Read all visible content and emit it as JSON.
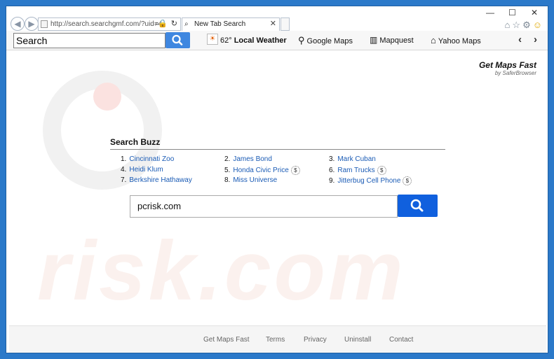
{
  "browser": {
    "address_url": "http://search.searchgmf.com/?uid=4",
    "tab_title": "New Tab Search",
    "back_icon": "back-arrow-icon",
    "forward_icon": "forward-arrow-icon"
  },
  "toolbar": {
    "search_value": "Search",
    "weather": {
      "temp": "62°",
      "label": "Local Weather"
    },
    "links": [
      "Google Maps",
      "Mapquest",
      "Yahoo Maps"
    ]
  },
  "brand": {
    "name": "Get Maps Fast",
    "by": "by SaferBrowser"
  },
  "buzz": {
    "title": "Search Buzz",
    "items": [
      {
        "num": "1.",
        "label": "Cincinnati Zoo"
      },
      {
        "num": "2.",
        "label": "James Bond"
      },
      {
        "num": "3.",
        "label": "Mark Cuban"
      },
      {
        "num": "4.",
        "label": "Heidi Klum"
      },
      {
        "num": "5.",
        "label": "Honda Civic Price"
      },
      {
        "num": "6.",
        "label": "Ram Trucks"
      },
      {
        "num": "7.",
        "label": "Berkshire Hathaway"
      },
      {
        "num": "8.",
        "label": "Miss Universe"
      },
      {
        "num": "9.",
        "label": "Jitterbug Cell Phone"
      }
    ],
    "dollar": "$"
  },
  "main_search": {
    "value": "pcrisk.com"
  },
  "footer": {
    "links": [
      "Get Maps Fast",
      "Terms",
      "Privacy",
      "Uninstall",
      "Contact"
    ]
  },
  "watermark": "risk.com",
  "colors": {
    "accent": "#1060de",
    "toolbar_button": "#3f87e0",
    "link": "#1a5bb5"
  }
}
